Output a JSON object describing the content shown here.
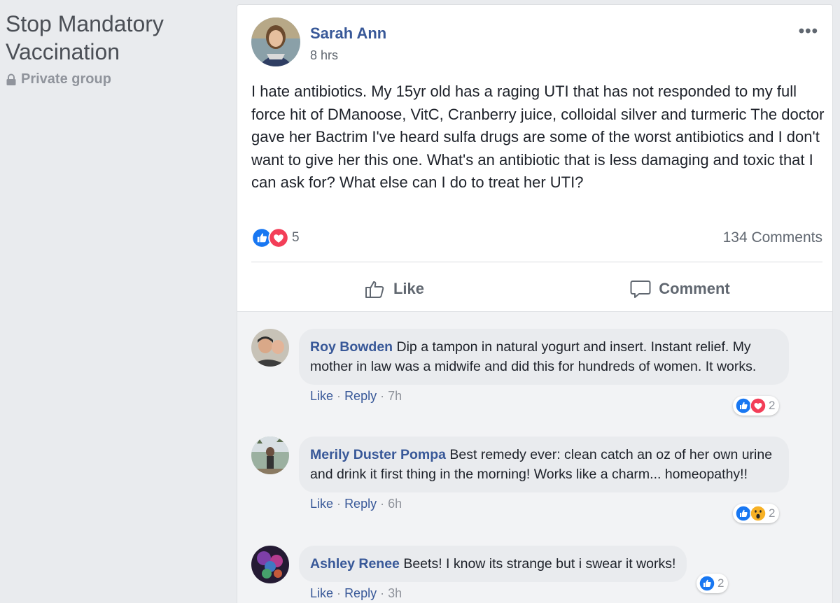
{
  "group": {
    "title": "Stop Mandatory Vaccination",
    "privacy_label": "Private group"
  },
  "post": {
    "author": "Sarah Ann",
    "time": "8 hrs",
    "body": "I hate antibiotics. My 15yr old has a raging UTI that has not responded to my full force hit of DManoose, VitC, Cranberry juice, colloidal silver and turmeric The doctor gave her Bactrim I've heard sulfa drugs are some of the worst antibiotics and I don't want to give her this one. What's an antibiotic that is less damaging and toxic that I can ask for? What else can I do to treat her UTI?",
    "reaction_count": "5",
    "comments_count": "134 Comments",
    "reactions": [
      "like-icon",
      "love-icon"
    ]
  },
  "actions": {
    "like_label": "Like",
    "comment_label": "Comment"
  },
  "comments": [
    {
      "name": "Roy Bowden",
      "text": "Dip a tampon in natural yogurt and insert. Instant relief. My mother in law was a midwife and did this for hundreds of women. It works.",
      "like_label": "Like",
      "reply_label": "Reply",
      "time": "7h",
      "reaction_count": "2",
      "reactions": [
        "like-icon",
        "love-icon"
      ]
    },
    {
      "name": "Merily Duster Pompa",
      "text": "Best remedy ever: clean catch an oz of her own urine and drink it first thing in the morning! Works like a charm... homeopathy!!",
      "like_label": "Like",
      "reply_label": "Reply",
      "time": "6h",
      "reaction_count": "2",
      "reactions": [
        "like-icon",
        "wow-icon"
      ]
    },
    {
      "name": "Ashley Renee",
      "text": "Beets! I know its strange but i swear it works!",
      "like_label": "Like",
      "reply_label": "Reply",
      "time": "3h",
      "reaction_count": "2",
      "reactions": [
        "like-icon"
      ]
    }
  ],
  "colors": {
    "link_blue": "#385898",
    "like_blue": "#1877f2",
    "love_red": "#f33e58",
    "wow_yellow": "#f7b125",
    "background": "#e9ebee"
  }
}
